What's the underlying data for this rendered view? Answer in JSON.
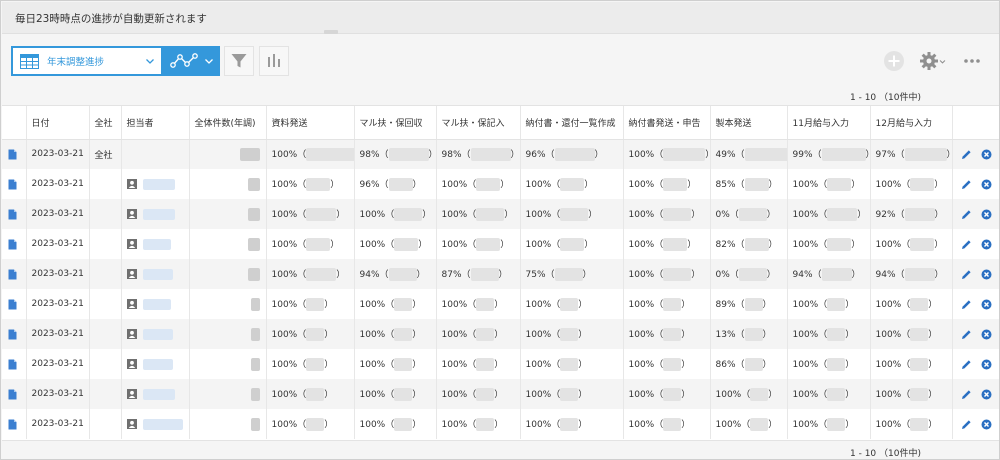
{
  "notice": "毎日23時時点の進捗が自動更新されます",
  "view": {
    "name": "年末調整進捗"
  },
  "pager": "1 - 10 （10件中)",
  "columns": [
    "",
    "日付",
    "全社",
    "担当者",
    "全体件数(年調)",
    "資料発送",
    "マル扶・保回収",
    "マル扶・保記入",
    "納付書・還付一覧作成",
    "納付書発送・申告",
    "製本発送",
    "11月給与入力",
    "12月給与入力",
    ""
  ],
  "rows": [
    {
      "date": "2023-03-21",
      "company": "全社",
      "cells": [
        "100%",
        "98%",
        "98%",
        "96%",
        "100%",
        "49%",
        "99%",
        "97%"
      ]
    },
    {
      "date": "2023-03-21",
      "company": "",
      "cells": [
        "100%",
        "96%",
        "100%",
        "100%",
        "100%",
        "85%",
        "100%",
        "100%"
      ]
    },
    {
      "date": "2023-03-21",
      "company": "",
      "cells": [
        "100%",
        "100%",
        "100%",
        "100%",
        "100%",
        "0%",
        "100%",
        "92%"
      ]
    },
    {
      "date": "2023-03-21",
      "company": "",
      "cells": [
        "100%",
        "100%",
        "100%",
        "100%",
        "100%",
        "82%",
        "100%",
        "100%"
      ]
    },
    {
      "date": "2023-03-21",
      "company": "",
      "cells": [
        "100%",
        "94%",
        "87%",
        "75%",
        "100%",
        "0%",
        "94%",
        "94%"
      ]
    },
    {
      "date": "2023-03-21",
      "company": "",
      "cells": [
        "100%",
        "100%",
        "100%",
        "100%",
        "100%",
        "89%",
        "100%",
        "100%"
      ]
    },
    {
      "date": "2023-03-21",
      "company": "",
      "cells": [
        "100%",
        "100%",
        "100%",
        "100%",
        "100%",
        "13%",
        "100%",
        "100%"
      ]
    },
    {
      "date": "2023-03-21",
      "company": "",
      "cells": [
        "100%",
        "100%",
        "100%",
        "100%",
        "100%",
        "86%",
        "100%",
        "100%"
      ]
    },
    {
      "date": "2023-03-21",
      "company": "",
      "cells": [
        "100%",
        "100%",
        "100%",
        "100%",
        "100%",
        "100%",
        "100%",
        "100%"
      ]
    },
    {
      "date": "2023-03-21",
      "company": "",
      "cells": [
        "100%",
        "100%",
        "100%",
        "100%",
        "100%",
        "100%",
        "100%",
        "100%"
      ]
    }
  ],
  "colors": {
    "accent": "#3498db",
    "row_alt": "#f4f4f4",
    "doc_icon": "#3b7fd1"
  }
}
